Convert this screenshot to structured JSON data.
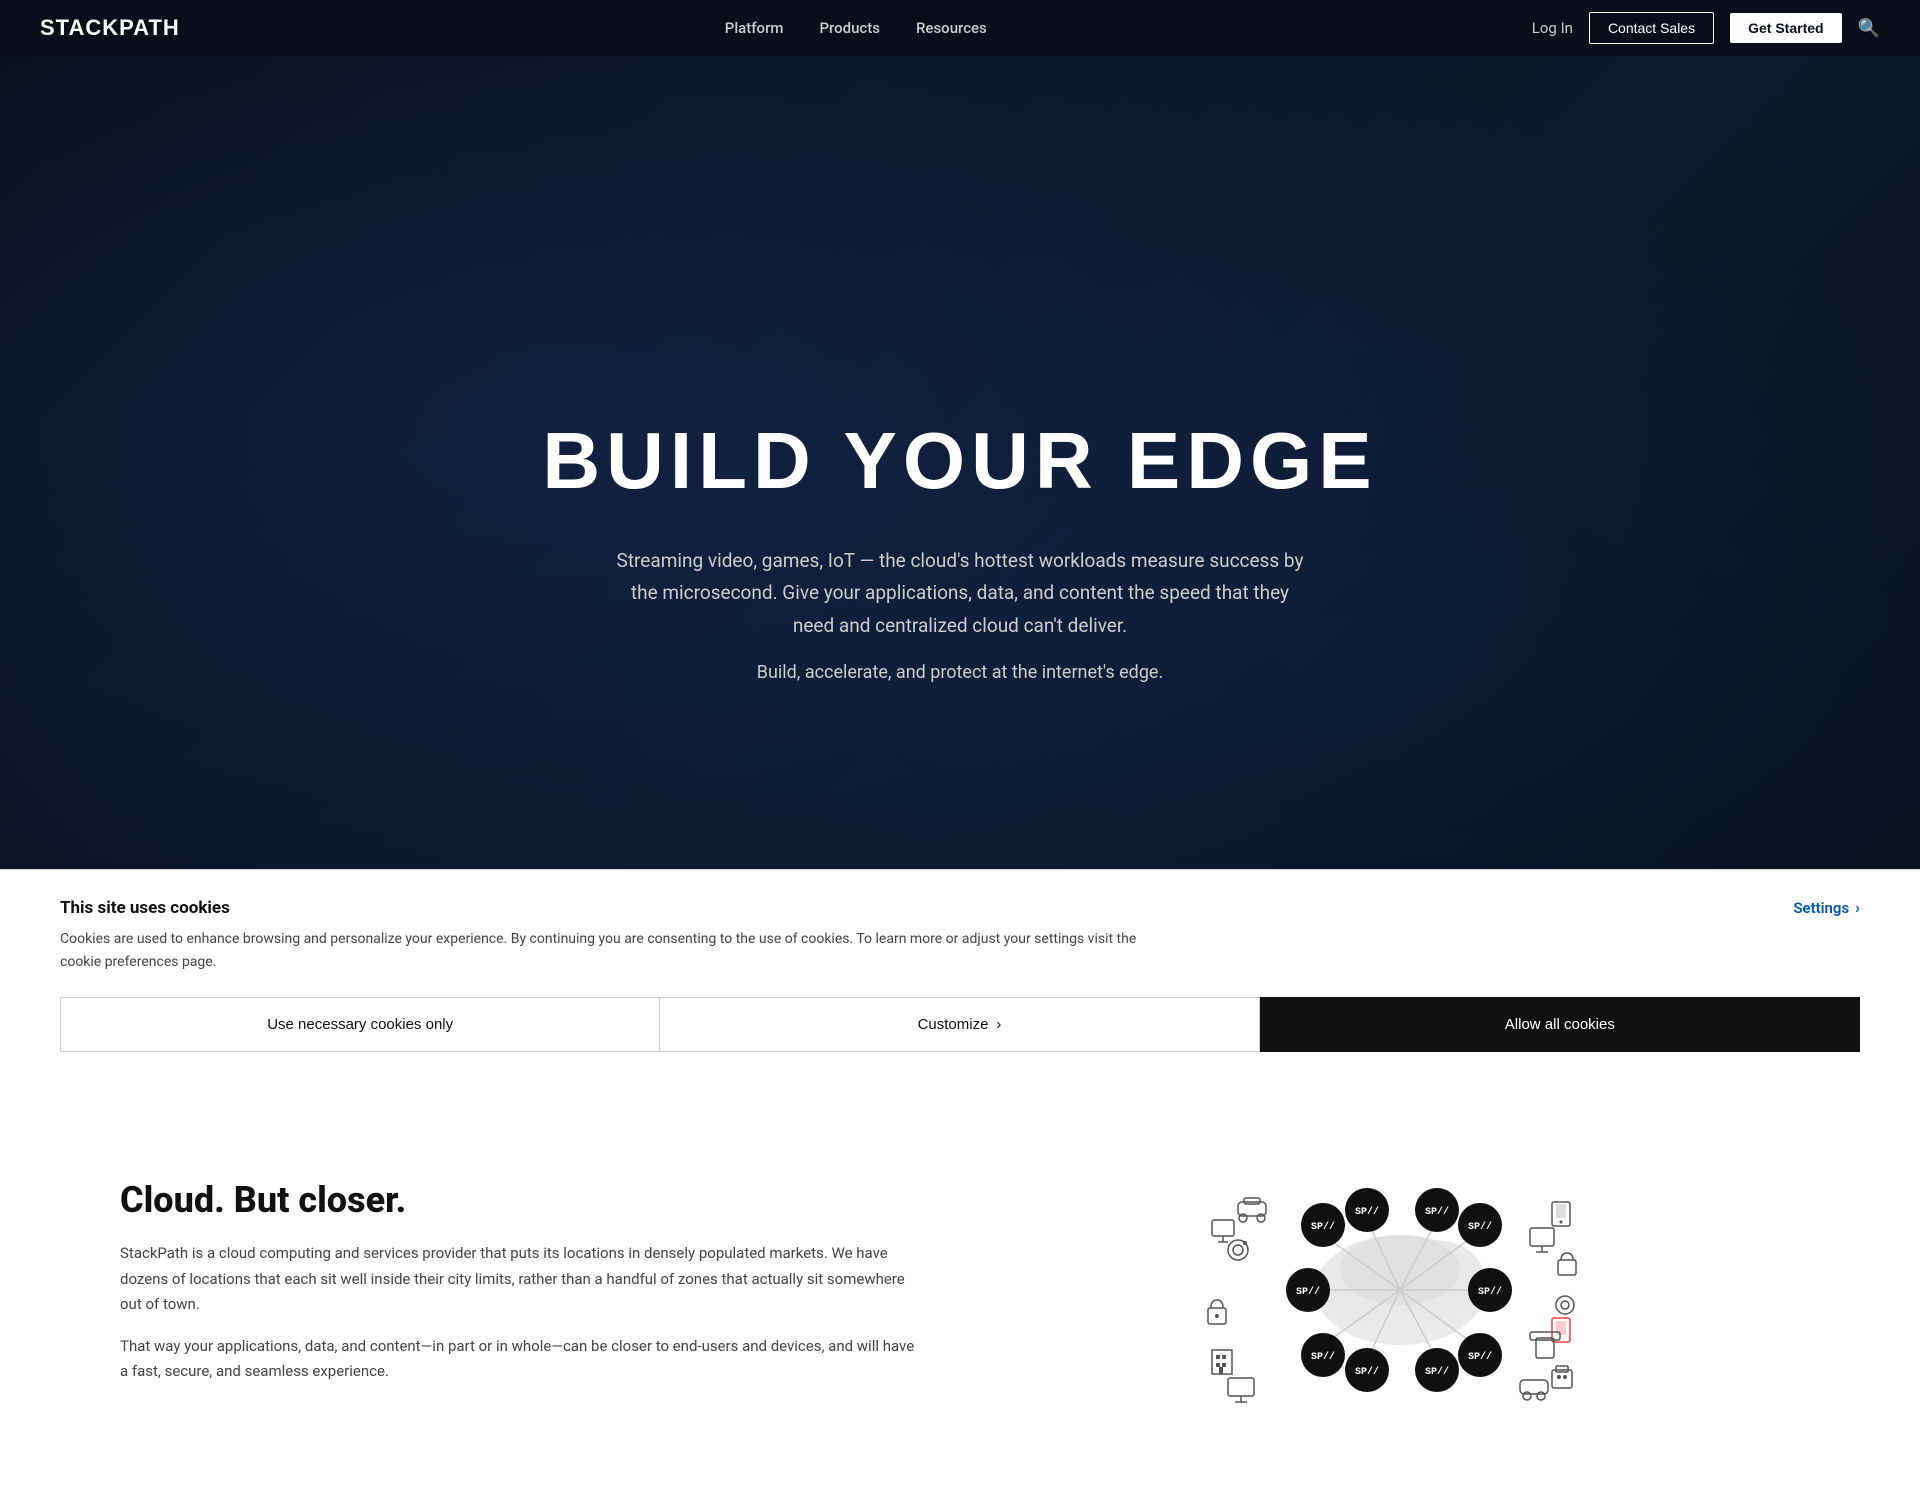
{
  "brand": {
    "logo": "STACKPATH"
  },
  "nav": {
    "links": [
      {
        "id": "platform",
        "label": "Platform"
      },
      {
        "id": "products",
        "label": "Products"
      },
      {
        "id": "resources",
        "label": "Resources"
      }
    ],
    "login_label": "Log In",
    "contact_label": "Contact Sales",
    "get_started_label": "Get Started"
  },
  "hero": {
    "title": "BUILD YOUR EDGE",
    "subtitle": "Streaming video, games, IoT — the cloud's hottest workloads measure success by the microsecond. Give your applications, data, and content the speed that they need and centralized cloud can't deliver.",
    "sub2": "Build, accelerate, and protect at the internet's edge."
  },
  "cloud_section": {
    "heading": "Cloud. But closer.",
    "para1": "StackPath is a cloud computing and services provider that puts its locations in densely populated markets. We have dozens of locations that each sit well inside their city limits, rather than a handful of zones that actually sit somewhere out of town.",
    "para2": "That way your applications, data, and content—in part or in whole—can be closer to end-users and devices, and will have a fast, secure, and seamless experience."
  },
  "cookie_banner": {
    "title": "This site uses cookies",
    "description": "Cookies are used to enhance browsing and personalize your experience. By continuing you are consenting to the use of cookies. To learn more or adjust your settings visit the cookie preferences page.",
    "settings_label": "Settings",
    "btn_necessary": "Use necessary cookies only",
    "btn_customize": "Customize",
    "btn_allow": "Allow all cookies"
  }
}
